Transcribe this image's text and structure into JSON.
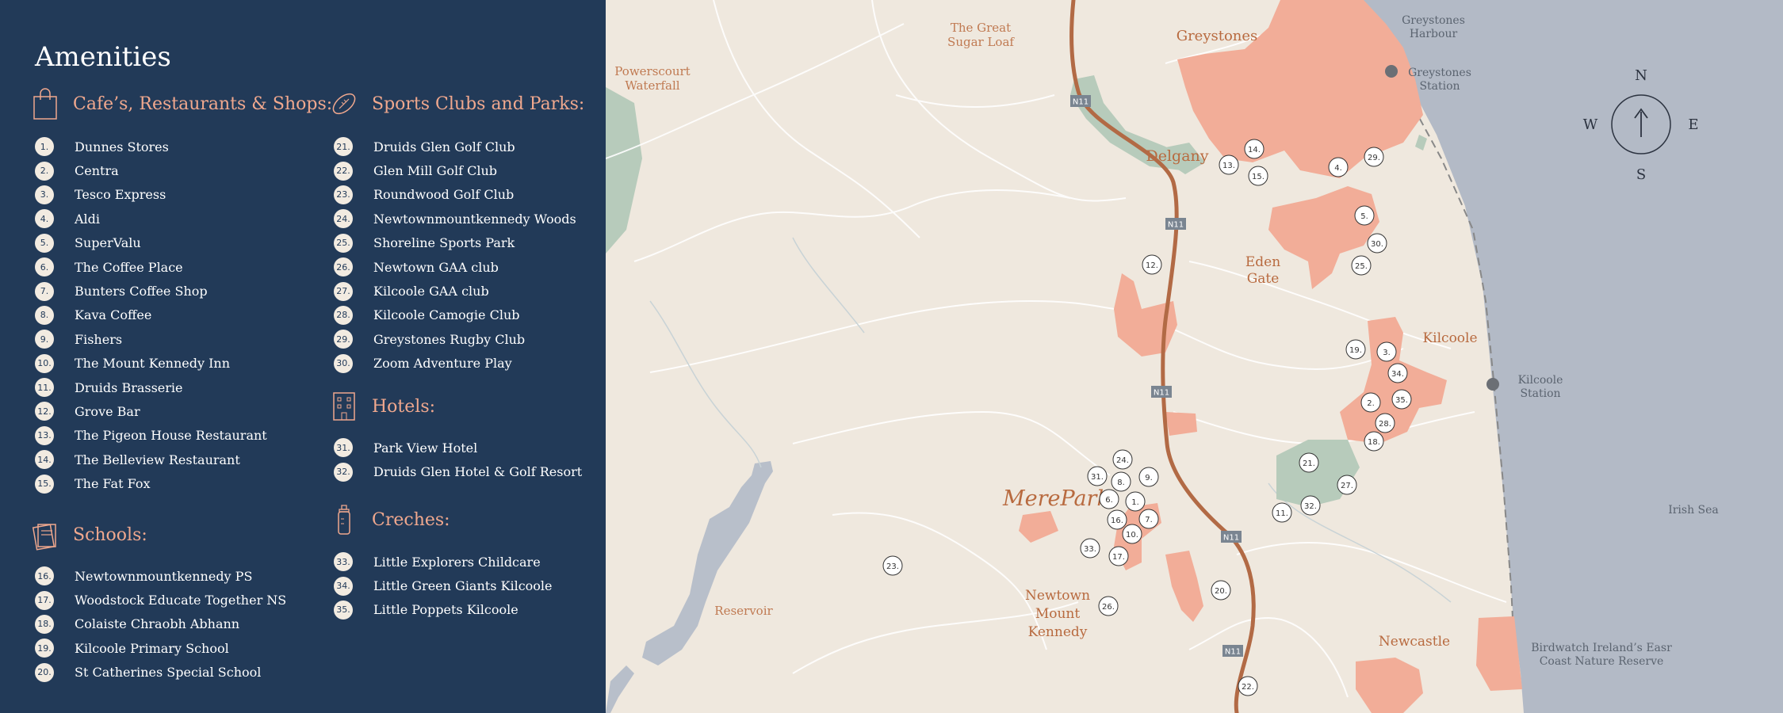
{
  "panel": {
    "title": "Amenities",
    "sections": {
      "cafes": {
        "heading": "Cafe’s, Restaurants & Shops:",
        "icon": "shopping-bag-icon",
        "items": [
          {
            "num": "1.",
            "label": "Dunnes Stores"
          },
          {
            "num": "2.",
            "label": "Centra"
          },
          {
            "num": "3.",
            "label": "Tesco Express"
          },
          {
            "num": "4.",
            "label": "Aldi"
          },
          {
            "num": "5.",
            "label": "SuperValu"
          },
          {
            "num": "6.",
            "label": "The Coffee Place"
          },
          {
            "num": "7.",
            "label": "Bunters Coffee Shop"
          },
          {
            "num": "8.",
            "label": "Kava Coffee"
          },
          {
            "num": "9.",
            "label": "Fishers"
          },
          {
            "num": "10.",
            "label": "The Mount Kennedy Inn"
          },
          {
            "num": "11.",
            "label": "Druids Brasserie"
          },
          {
            "num": "12.",
            "label": "Grove Bar"
          },
          {
            "num": "13.",
            "label": "The Pigeon House Restaurant"
          },
          {
            "num": "14.",
            "label": "The Belleview Restaurant"
          },
          {
            "num": "15.",
            "label": "The Fat Fox"
          }
        ]
      },
      "schools": {
        "heading": "Schools:",
        "icon": "books-icon",
        "items": [
          {
            "num": "16.",
            "label": "Newtownmountkennedy PS"
          },
          {
            "num": "17.",
            "label": "Woodstock Educate Together NS"
          },
          {
            "num": "18.",
            "label": "Colaiste Chraobh Abhann"
          },
          {
            "num": "19.",
            "label": "Kilcoole Primary School"
          },
          {
            "num": "20.",
            "label": "St Catherines Special School"
          }
        ]
      },
      "sports": {
        "heading": "Sports Clubs and Parks:",
        "icon": "rugby-ball-icon",
        "items": [
          {
            "num": "21.",
            "label": "Druids Glen Golf Club"
          },
          {
            "num": "22.",
            "label": "Glen Mill Golf Club"
          },
          {
            "num": "23.",
            "label": "Roundwood Golf Club"
          },
          {
            "num": "24.",
            "label": "Newtownmountkennedy Woods"
          },
          {
            "num": "25.",
            "label": "Shoreline Sports Park"
          },
          {
            "num": "26.",
            "label": "Newtown GAA club"
          },
          {
            "num": "27.",
            "label": "Kilcoole GAA club"
          },
          {
            "num": "28.",
            "label": "Kilcoole Camogie Club"
          },
          {
            "num": "29.",
            "label": "Greystones Rugby Club"
          },
          {
            "num": "30.",
            "label": "Zoom Adventure Play"
          }
        ]
      },
      "hotels": {
        "heading": "Hotels:",
        "icon": "building-icon",
        "items": [
          {
            "num": "31.",
            "label": "Park View Hotel"
          },
          {
            "num": "32.",
            "label": "Druids Glen Hotel & Golf Resort"
          }
        ]
      },
      "creches": {
        "heading": "Creches:",
        "icon": "baby-bottle-icon",
        "items": [
          {
            "num": "33.",
            "label": "Little Explorers Childcare"
          },
          {
            "num": "34.",
            "label": "Little Green Giants Kilcoole"
          },
          {
            "num": "35.",
            "label": "Little Poppets Kilcoole"
          }
        ]
      }
    }
  },
  "map": {
    "colors": {
      "land": "#efe8de",
      "sea": "#b3bac6",
      "town": "#f2ad98",
      "park": "#b7cbbb",
      "water": "#b8bfca",
      "road": "#b26a45",
      "panel": "#223a58",
      "accent": "#f0a88e",
      "place_text": "#b86a3f"
    },
    "places": {
      "greystones": "Greystones",
      "delgany": "Delgany",
      "eden_gate_1": "Eden",
      "eden_gate_2": "Gate",
      "kilcoole": "Kilcoole",
      "newtown_1": "Newtown",
      "newtown_2": "Mount",
      "newtown_3": "Kennedy",
      "newcastle": "Newcastle",
      "great_sugar_loaf_1": "The Great",
      "great_sugar_loaf_2": "Sugar Loaf",
      "powerscourt_1": "Powerscourt",
      "powerscourt_2": "Waterfall",
      "reservoir": "Reservoir",
      "greystones_harbour_1": "Greystones",
      "greystones_harbour_2": "Harbour",
      "greystones_station_1": "Greystones",
      "greystones_station_2": "Station",
      "kilcoole_station_1": "Kilcoole",
      "kilcoole_station_2": "Station",
      "irish_sea": "Irish Sea",
      "birdwatch_1": "Birdwatch Ireland’s Easr",
      "birdwatch_2": "Coast Nature Reserve",
      "merepark": "MerePark"
    },
    "road_label": "N11",
    "compass": {
      "n": "N",
      "s": "S",
      "e": "E",
      "w": "W",
      "icon": "compass-icon"
    },
    "markers": [
      "1.",
      "2.",
      "3.",
      "4.",
      "5.",
      "6.",
      "7.",
      "8.",
      "9.",
      "10.",
      "11.",
      "12.",
      "13.",
      "14.",
      "15.",
      "16.",
      "17.",
      "18.",
      "19.",
      "20.",
      "21.",
      "22.",
      "23.",
      "24.",
      "25.",
      "26.",
      "27.",
      "28.",
      "29.",
      "30.",
      "31.",
      "32.",
      "33.",
      "34.",
      "35."
    ]
  }
}
